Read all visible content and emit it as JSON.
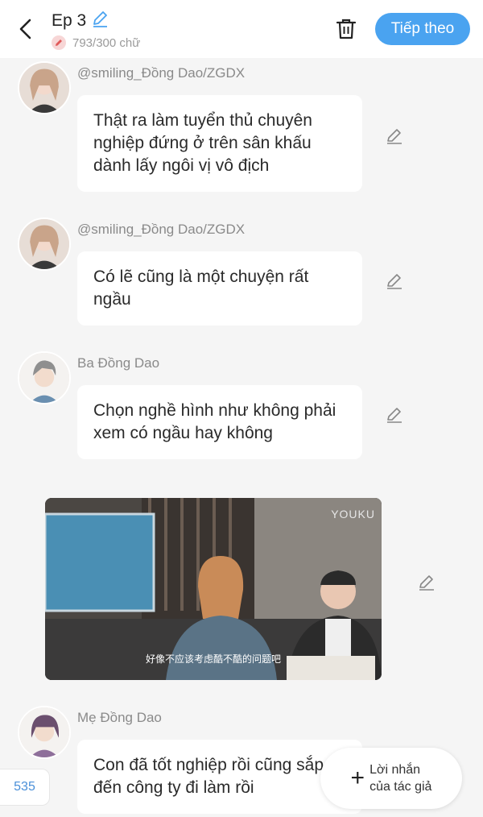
{
  "header": {
    "title": "Ep 3",
    "char_count": "793/300 chữ",
    "next_label": "Tiếp theo"
  },
  "messages": [
    {
      "name": "@smiling_Đồng Dao/ZGDX",
      "text": "Thật ra làm tuyển thủ chuyên nghiệp đứng ở trên sân khấu dành lấy ngôi vị vô địch"
    },
    {
      "name": "@smiling_Đồng Dao/ZGDX",
      "text": "Có lẽ cũng là một chuyện rất ngầu"
    },
    {
      "name": "Ba Đồng Dao",
      "text": "Chọn nghề hình như không phải xem có ngầu hay không"
    },
    {
      "name": "Mẹ Đồng Dao",
      "text": "Con đã tốt nghiệp rồi cũng sắp đến công ty đi làm rồi"
    }
  ],
  "video": {
    "watermark": "YOUKU",
    "subtitle": "好像不应该考虑酷不酷的问题吧"
  },
  "footer": {
    "counter": "535",
    "author_note_line1": "Lời nhắn",
    "author_note_line2": "của tác giả"
  },
  "colors": {
    "accent": "#4aa3f0",
    "background": "#f5f5f5",
    "bubble": "#ffffff"
  },
  "icons": [
    "back-arrow-icon",
    "pencil-icon",
    "trash-icon",
    "edit-pencil-icon",
    "plus-icon"
  ]
}
